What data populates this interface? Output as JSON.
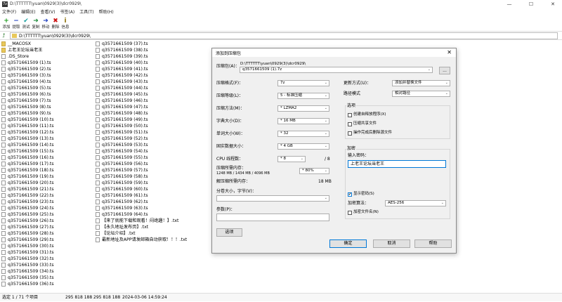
{
  "window": {
    "title": "D:\\TTTTTT\\yuan\\0929(3)\\dcr0929\\",
    "icon_label": "7z",
    "min_glyph": "—",
    "max_glyph": "☐",
    "close_glyph": "✕"
  },
  "menu": [
    "文件(F)",
    "编辑(E)",
    "查看(V)",
    "书签(A)",
    "工具(T)",
    "帮助(H)"
  ],
  "toolbar": [
    {
      "label": "添加",
      "icon": "plus-icon",
      "glyph": "+",
      "color": "#1e9b1e"
    },
    {
      "label": "提取",
      "icon": "minus-icon",
      "glyph": "−",
      "color": "#1f3fbf"
    },
    {
      "label": "测试",
      "icon": "check-icon",
      "glyph": "✔",
      "color": "#1aa0a0"
    },
    {
      "label": "复制",
      "icon": "copy-arrow-icon",
      "glyph": "➜",
      "color": "#1e8c3a"
    },
    {
      "label": "移动",
      "icon": "move-arrow-icon",
      "glyph": "➜",
      "color": "#1f3fbf"
    },
    {
      "label": "删除",
      "icon": "delete-x-icon",
      "glyph": "✖",
      "color": "#cc1111"
    },
    {
      "label": "信息",
      "icon": "info-icon",
      "glyph": "i",
      "color": "#8a6d00"
    }
  ],
  "address": {
    "up_glyph": "⮥",
    "path": "D:\\TTTTTT\\yuan\\0929(3)\\dcr0929\\"
  },
  "files_col1": [
    {
      "name": "__MACOSX",
      "folder": true
    },
    {
      "name": "上老王论坛当老王",
      "folder": true
    },
    {
      "name": ".DS_Store",
      "folder": false
    },
    {
      "name": "q3571661509 (1).ts",
      "folder": false
    },
    {
      "name": "q3571661509 (2).ts",
      "folder": false
    },
    {
      "name": "q3571661509 (3).ts",
      "folder": false
    },
    {
      "name": "q3571661509 (4).ts",
      "folder": false
    },
    {
      "name": "q3571661509 (5).ts",
      "folder": false
    },
    {
      "name": "q3571661509 (6).ts",
      "folder": false
    },
    {
      "name": "q3571661509 (7).ts",
      "folder": false
    },
    {
      "name": "q3571661509 (8).ts",
      "folder": false
    },
    {
      "name": "q3571661509 (9).ts",
      "folder": false
    },
    {
      "name": "q3571661509 (10).ts",
      "folder": false
    },
    {
      "name": "q3571661509 (11).ts",
      "folder": false
    },
    {
      "name": "q3571661509 (12).ts",
      "folder": false
    },
    {
      "name": "q3571661509 (13).ts",
      "folder": false
    },
    {
      "name": "q3571661509 (14).ts",
      "folder": false
    },
    {
      "name": "q3571661509 (15).ts",
      "folder": false
    },
    {
      "name": "q3571661509 (16).ts",
      "folder": false
    },
    {
      "name": "q3571661509 (17).ts",
      "folder": false
    },
    {
      "name": "q3571661509 (18).ts",
      "folder": false
    },
    {
      "name": "q3571661509 (19).ts",
      "folder": false
    },
    {
      "name": "q3571661509 (20).ts",
      "folder": false
    },
    {
      "name": "q3571661509 (21).ts",
      "folder": false
    },
    {
      "name": "q3571661509 (22).ts",
      "folder": false
    },
    {
      "name": "q3571661509 (23).ts",
      "folder": false
    },
    {
      "name": "q3571661509 (24).ts",
      "folder": false
    },
    {
      "name": "q3571661509 (25).ts",
      "folder": false
    },
    {
      "name": "q3571661509 (26).ts",
      "folder": false
    },
    {
      "name": "q3571661509 (27).ts",
      "folder": false
    },
    {
      "name": "q3571661509 (28).ts",
      "folder": false
    },
    {
      "name": "q3571661509 (29).ts",
      "folder": false
    },
    {
      "name": "q3571661509 (30).ts",
      "folder": false
    },
    {
      "name": "q3571661509 (31).ts",
      "folder": false
    },
    {
      "name": "q3571661509 (32).ts",
      "folder": false
    },
    {
      "name": "q3571661509 (33).ts",
      "folder": false
    },
    {
      "name": "q3571661509 (34).ts",
      "folder": false
    },
    {
      "name": "q3571661509 (35).ts",
      "folder": false
    },
    {
      "name": "q3571661509 (36).ts",
      "folder": false
    }
  ],
  "files_col2": [
    {
      "name": "q3571661509 (37).ts",
      "folder": false
    },
    {
      "name": "q3571661509 (38).ts",
      "folder": false
    },
    {
      "name": "q3571661509 (39).ts",
      "folder": false
    },
    {
      "name": "q3571661509 (40).ts",
      "folder": false
    },
    {
      "name": "q3571661509 (41).ts",
      "folder": false
    },
    {
      "name": "q3571661509 (42).ts",
      "folder": false
    },
    {
      "name": "q3571661509 (43).ts",
      "folder": false
    },
    {
      "name": "q3571661509 (44).ts",
      "folder": false
    },
    {
      "name": "q3571661509 (45).ts",
      "folder": false
    },
    {
      "name": "q3571661509 (46).ts",
      "folder": false
    },
    {
      "name": "q3571661509 (47).ts",
      "folder": false
    },
    {
      "name": "q3571661509 (48).ts",
      "folder": false
    },
    {
      "name": "q3571661509 (49).ts",
      "folder": false
    },
    {
      "name": "q3571661509 (50).ts",
      "folder": false
    },
    {
      "name": "q3571661509 (51).ts",
      "folder": false
    },
    {
      "name": "q3571661509 (52).ts",
      "folder": false
    },
    {
      "name": "q3571661509 (53).ts",
      "folder": false
    },
    {
      "name": "q3571661509 (54).ts",
      "folder": false
    },
    {
      "name": "q3571661509 (55).ts",
      "folder": false
    },
    {
      "name": "q3571661509 (56).ts",
      "folder": false
    },
    {
      "name": "q3571661509 (57).ts",
      "folder": false
    },
    {
      "name": "q3571661509 (58).ts",
      "folder": false
    },
    {
      "name": "q3571661509 (59).ts",
      "folder": false
    },
    {
      "name": "q3571661509 (60).ts",
      "folder": false
    },
    {
      "name": "q3571661509 (61).ts",
      "folder": false
    },
    {
      "name": "q3571661509 (62).ts",
      "folder": false
    },
    {
      "name": "q3571661509 (63).ts",
      "folder": false
    },
    {
      "name": "q3571661509 (64).ts",
      "folder": false
    },
    {
      "name": "【来了就能下载和观看！闷绝趣！】.txt",
      "folder": false
    },
    {
      "name": "【永久地址发布页】.txt",
      "folder": false
    },
    {
      "name": "【论坛介绍】.txt",
      "folder": false
    },
    {
      "name": "最新地址及APP请发邮箱自动获取！！！.txt",
      "folder": false
    }
  ],
  "statusbar": {
    "selection": "选定 1 / 71 个项目",
    "size1": "295 818 188",
    "size2": "295 818 188",
    "modified": "2024-03-06 14:59:24"
  },
  "dialog": {
    "title": "添加到压缩包",
    "close_glyph": "✕",
    "archive_label": "压缩包(A)：",
    "archive_dir": "D:\\TTTTTT\\yuan\\0929(3)\\dcr0929\\",
    "archive_name": "q3571661509 (1).7z",
    "browse_label": "...",
    "format_label": "压缩格式(F)：",
    "format_value": "7z",
    "level_label": "压缩等级(L)：",
    "level_value": "5 - 标准压缩",
    "method_label": "压缩方法(M)：",
    "method_value": "* LZMA2",
    "dict_label": "字典大小(D)：",
    "dict_value": "* 16 MB",
    "word_label": "单词大小(W)：",
    "word_value": "* 32",
    "solid_label": "固实数据大小：",
    "solid_value": "* 4 GB",
    "threads_label": "CPU 线程数：",
    "threads_value": "* 8",
    "threads_max": "/ 8",
    "mem_label": "压缩所需内存：",
    "mem_detail": "1248 MB / 1434 MB / 4096 MB",
    "mem_pct": "* 80%",
    "decomp_label": "解压缩所需内存：",
    "decomp_value": "18 MB",
    "split_label": "分卷大小，字节(V)：",
    "params_label": "参数(P)：",
    "options_btn": "选项",
    "update_label": "更新方式(U)：",
    "update_value": "添加并替换文件",
    "pathmode_label": "路径模式",
    "pathmode_value": "相对路径",
    "options_group": "选项",
    "opt_sfx": "创建自释放程序(X)",
    "opt_shared": "压缩共享文件",
    "opt_delete": "操作完成后删除源文件",
    "encrypt_group": "加密",
    "password_label": "输入密码：",
    "password_value": "上老王论坛当老王",
    "show_pw": "显示密码(S)",
    "show_pw_checked": "✔",
    "enc_method_label": "加密算法：",
    "enc_method_value": "AES-256",
    "enc_names": "加密文件名(N)",
    "ok": "确定",
    "cancel": "取消",
    "help": "帮助",
    "dropdown_glyph": "⌄"
  }
}
